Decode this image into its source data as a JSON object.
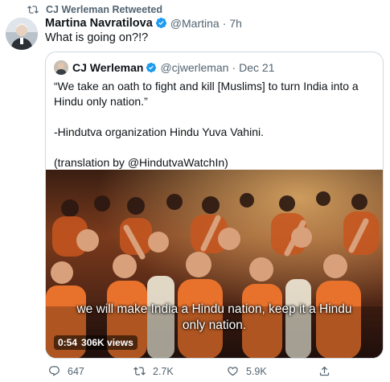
{
  "retweet": {
    "text": "CJ Werleman Retweeted",
    "icon": "retweet-icon"
  },
  "tweet": {
    "author_name": "Martina Navratilova",
    "author_handle": "@Martina",
    "separator": "·",
    "time": "7h",
    "text": "What is going on?!?",
    "verified_color": "#1d9bf0"
  },
  "quote": {
    "author_name": "CJ Werleman",
    "author_handle": "@cjwerleman",
    "separator": "·",
    "time": "Dec 21",
    "lines": [
      "“We take an oath to fight and kill [Muslims] to turn India into a Hindu only nation.”",
      "-Hindutva organization Hindu Yuva Vahini.",
      "(translation by @HindutvaWatchIn)"
    ]
  },
  "video": {
    "subtitle_line1": "we will make India a Hindu nation, keep it a Hindu",
    "subtitle_line2": "only nation.",
    "duration": "0:54",
    "views": "306K views"
  },
  "actions": {
    "replies": "647",
    "retweets": "2.7K",
    "likes": "5.9K"
  }
}
